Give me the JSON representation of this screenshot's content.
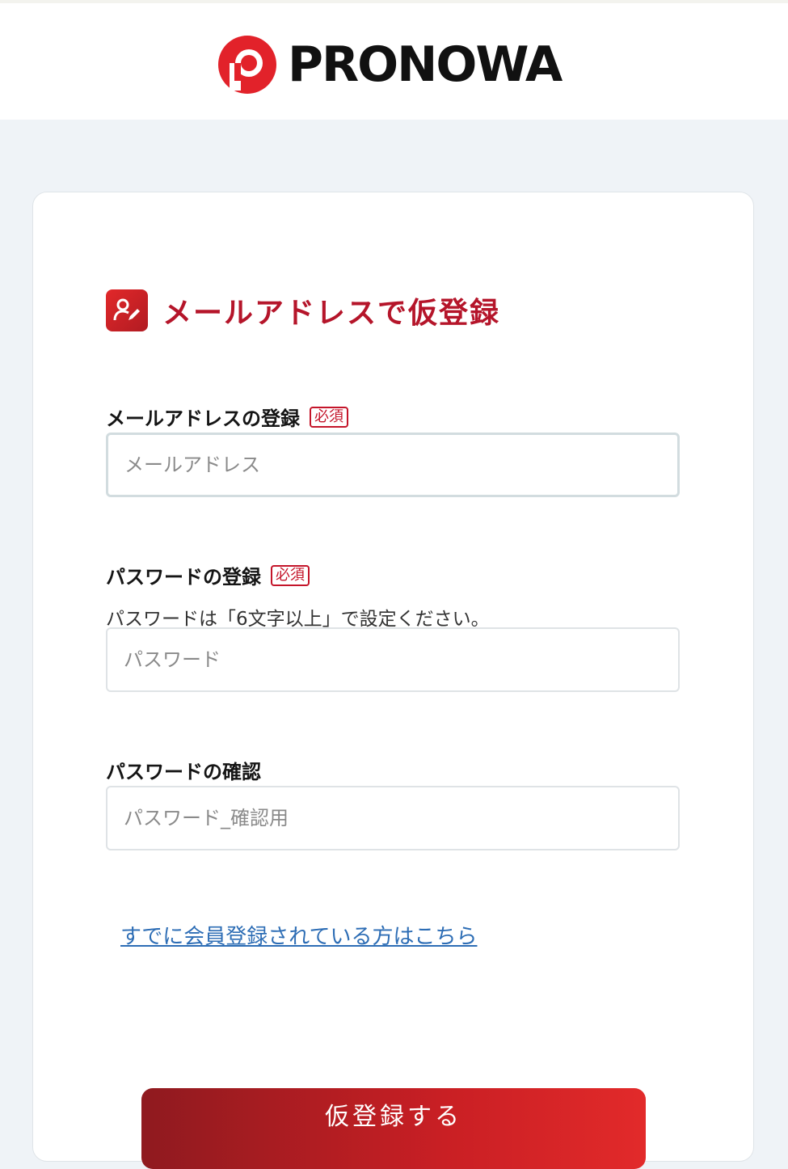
{
  "header": {
    "logo_text": "PRONOWA",
    "logo_icon": "pronowa-p-logo-icon",
    "brand_color": "#e2222a"
  },
  "form": {
    "title": "メールアドレスで仮登録",
    "title_icon": "user-edit-icon",
    "email": {
      "label": "メールアドレスの登録",
      "badge": "必須",
      "placeholder": "メールアドレス",
      "value": ""
    },
    "password": {
      "label": "パスワードの登録",
      "badge": "必須",
      "hint": "パスワードは「6文字以上」で設定ください。",
      "placeholder": "パスワード",
      "value": ""
    },
    "password_confirm": {
      "label": "パスワードの確認",
      "placeholder": "パスワード_確認用",
      "value": ""
    },
    "login_link": "すでに会員登録されている方はこちら",
    "submit_label": "仮登録する"
  },
  "colors": {
    "accent": "#b5152a",
    "link": "#2d6db5",
    "page_bg": "#eff3f7"
  }
}
